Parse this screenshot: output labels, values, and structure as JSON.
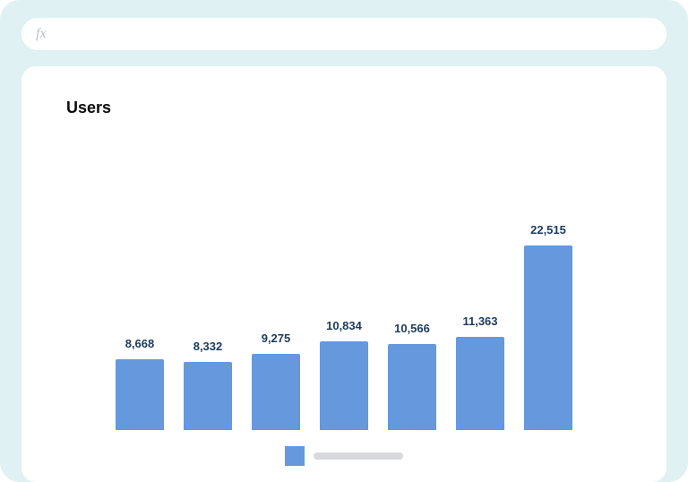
{
  "formula_bar": {
    "fx_label": "fx",
    "value": ""
  },
  "card": {
    "title": "Users"
  },
  "legend": {
    "series_name": ""
  },
  "colors": {
    "bar": "#6598dd",
    "background": "#dff1f3",
    "label": "#1c3b5c"
  },
  "chart_data": {
    "type": "bar",
    "title": "Users",
    "xlabel": "",
    "ylabel": "",
    "ylim": [
      0,
      23000
    ],
    "categories": [
      "",
      "",
      "",
      "",
      "",
      "",
      ""
    ],
    "values": [
      8668,
      8332,
      9275,
      10834,
      10566,
      11363,
      22515
    ],
    "value_labels": [
      "8,668",
      "8,332",
      "9,275",
      "10,834",
      "10,566",
      "11,363",
      "22,515"
    ],
    "series": [
      {
        "name": "",
        "values": [
          8668,
          8332,
          9275,
          10834,
          10566,
          11363,
          22515
        ]
      }
    ]
  }
}
